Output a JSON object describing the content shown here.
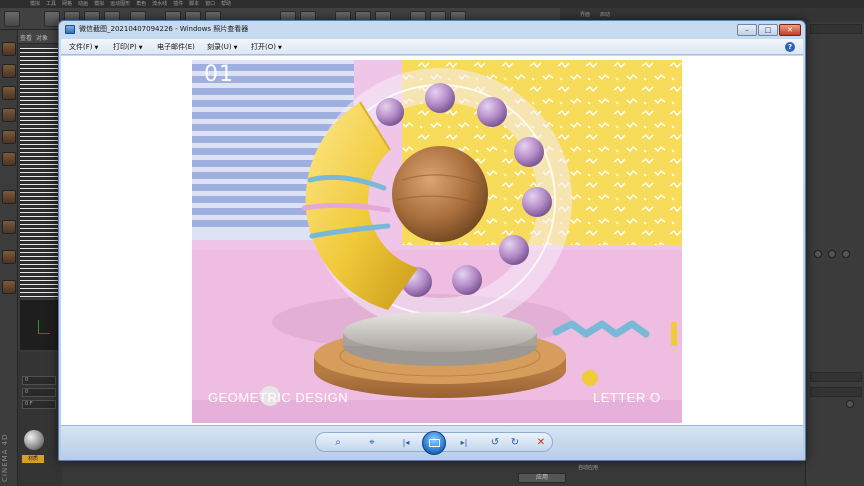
{
  "c4d": {
    "menu_items": [
      "模拟",
      "工具",
      "网格",
      "动画",
      "模拟",
      "运动图形",
      "角色",
      "流水线",
      "插件",
      "脚本",
      "窗口",
      "帮助"
    ],
    "right_menu": [
      "界面",
      "启动"
    ],
    "object_panel_tabs": [
      "查看",
      "对象"
    ],
    "fields": [
      "0",
      "0",
      "0 F"
    ],
    "brand": "CINEMA 4D",
    "material_label": "材质",
    "apply_button": "应用",
    "checkbox_label": "自动应用"
  },
  "photo_viewer": {
    "title": "微信截图_20210407094226 - Windows 照片查看器",
    "window_buttons": {
      "minimize": "–",
      "maximize": "□",
      "close": "✕"
    },
    "menus": [
      {
        "label": "文件(F)"
      },
      {
        "label": "打印(P)"
      },
      {
        "label": "电子邮件(E)"
      },
      {
        "label": "刻录(U)"
      },
      {
        "label": "打开(O)"
      }
    ],
    "help": "?",
    "controls": {
      "zoom": "⌕",
      "fit": "⌖",
      "prev": "|◂",
      "next": "▸|",
      "rotate_left": "↺",
      "rotate_right": "↻",
      "delete": "✕"
    }
  },
  "artwork": {
    "index": "01",
    "caption_left": "GEOMETRIC DESIGN",
    "caption_right": "LETTER O",
    "colors": {
      "pink": "#f0c4e6",
      "lilac_stripes": "#9fb0e0",
      "yellow": "#f6dc5a",
      "ring_yellow": "#f1cf45",
      "beads": "#b48cc8",
      "wood": "#b8804a",
      "squiggle": "#7ab8d8"
    }
  }
}
